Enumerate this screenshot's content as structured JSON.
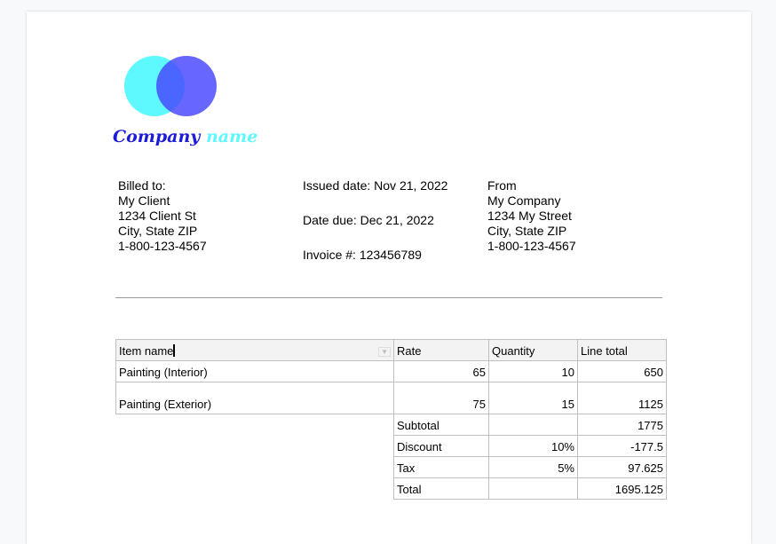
{
  "logo": {
    "text_part1": "Company",
    "text_part2": "name",
    "colors": {
      "left_circle": "#5ef8ff",
      "right_circle": "#5b5bff",
      "text1": "#1c1cd6",
      "text2": "#5ef8ff"
    }
  },
  "billed_to": {
    "label": "Billed to:",
    "name": "My Client",
    "street": "1234 Client St",
    "city": "City, State ZIP",
    "phone": "1-800-123-4567"
  },
  "dates": {
    "issued": "Issued date: Nov 21, 2022",
    "due": "Date due: Dec 21, 2022",
    "invoice": "Invoice #: 123456789"
  },
  "from": {
    "label": "From",
    "name": "My Company",
    "street": "1234 My Street",
    "city": "City, State ZIP",
    "phone": "1-800-123-4567"
  },
  "table": {
    "headers": [
      "Item name",
      "Rate",
      "Quantity",
      "Line total"
    ],
    "rows": [
      [
        "Painting (Interior)",
        "65",
        "10",
        "650"
      ],
      [
        "Painting (Exterior)",
        "75",
        "15",
        "1125"
      ]
    ],
    "summary": [
      [
        "Subtotal",
        "",
        "1775"
      ],
      [
        "Discount",
        "10%",
        "-177.5"
      ],
      [
        "Tax",
        "5%",
        "97.625"
      ],
      [
        "Total",
        "",
        "1695.125"
      ]
    ]
  }
}
